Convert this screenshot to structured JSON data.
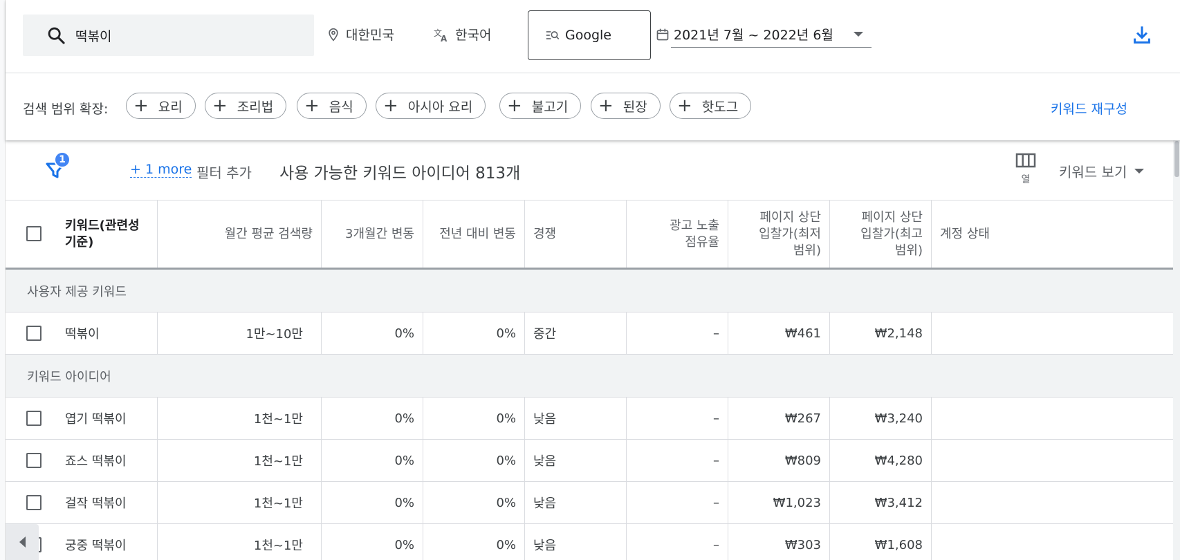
{
  "header": {
    "search_query": "떡볶이",
    "location": "대한민국",
    "language": "한국어",
    "network": "Google",
    "date_range": "2021년 7월 ~ 2022년 6월"
  },
  "expand": {
    "label": "검색 범위 확장:",
    "chips": [
      "요리",
      "조리법",
      "음식",
      "아시아 요리",
      "불고기",
      "된장",
      "핫도그"
    ],
    "rebuild_label": "키워드 재구성"
  },
  "toolbar": {
    "filter_badge": "1",
    "more_filters": "+ 1 more",
    "add_filter": "필터 추가",
    "keyword_count": "사용 가능한 키워드 아이디어 813개",
    "columns_label": "열",
    "view_label": "키워드 보기"
  },
  "table": {
    "headers": {
      "keyword": "키워드(관련성 기준)",
      "monthly": "월간 평균 검색량",
      "three_month": "3개월간 변동",
      "yoy": "전년 대비 변동",
      "competition": "경쟁",
      "impression_share": "광고 노출 점유율",
      "bid_low": "페이지 상단 입찰가(최저 범위)",
      "bid_high": "페이지 상단 입찰가(최고 범위)",
      "status": "계정 상태"
    },
    "group_user": "사용자 제공 키워드",
    "group_ideas": "키워드 아이디어",
    "user_rows": [
      {
        "keyword": "떡볶이",
        "monthly": "1만~10만",
        "three_month": "0%",
        "yoy": "0%",
        "competition": "중간",
        "impression_share": "–",
        "bid_low": "₩461",
        "bid_high": "₩2,148"
      }
    ],
    "idea_rows": [
      {
        "keyword": "엽기 떡볶이",
        "monthly": "1천~1만",
        "three_month": "0%",
        "yoy": "0%",
        "competition": "낮음",
        "impression_share": "–",
        "bid_low": "₩267",
        "bid_high": "₩3,240"
      },
      {
        "keyword": "죠스 떡볶이",
        "monthly": "1천~1만",
        "three_month": "0%",
        "yoy": "0%",
        "competition": "낮음",
        "impression_share": "–",
        "bid_low": "₩809",
        "bid_high": "₩4,280"
      },
      {
        "keyword": "걸작 떡볶이",
        "monthly": "1천~1만",
        "three_month": "0%",
        "yoy": "0%",
        "competition": "낮음",
        "impression_share": "–",
        "bid_low": "₩1,023",
        "bid_high": "₩3,412"
      },
      {
        "keyword": "궁중 떡볶이",
        "monthly": "1천~1만",
        "three_month": "0%",
        "yoy": "0%",
        "competition": "낮음",
        "impression_share": "–",
        "bid_low": "₩303",
        "bid_high": "₩1,608"
      }
    ]
  },
  "colors": {
    "accent": "#1a73e8",
    "badge": "#4285f4",
    "group_bg": "#f1f3f4"
  }
}
